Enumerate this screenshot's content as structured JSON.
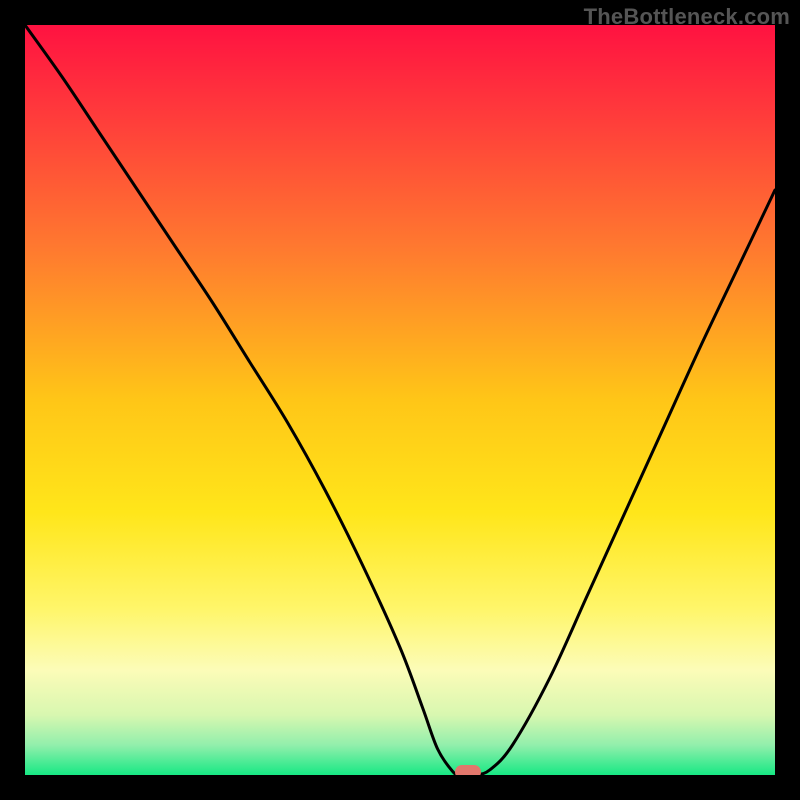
{
  "watermark": "TheBottleneck.com",
  "colors": {
    "frame": "#000000",
    "curve": "#000000",
    "marker": "#e2776c",
    "gradient_stops": [
      {
        "offset": 0.0,
        "color": "#ff1241"
      },
      {
        "offset": 0.12,
        "color": "#ff3b3b"
      },
      {
        "offset": 0.3,
        "color": "#ff7a2f"
      },
      {
        "offset": 0.5,
        "color": "#ffc617"
      },
      {
        "offset": 0.65,
        "color": "#ffe61a"
      },
      {
        "offset": 0.78,
        "color": "#fff66b"
      },
      {
        "offset": 0.86,
        "color": "#fcfcb8"
      },
      {
        "offset": 0.92,
        "color": "#d8f7b0"
      },
      {
        "offset": 0.96,
        "color": "#92efac"
      },
      {
        "offset": 1.0,
        "color": "#17e884"
      }
    ]
  },
  "chart_data": {
    "type": "line",
    "title": "",
    "xlabel": "",
    "ylabel": "",
    "xlim": [
      0,
      100
    ],
    "ylim": [
      0,
      100
    ],
    "series": [
      {
        "name": "bottleneck-curve",
        "x": [
          0,
          5,
          10,
          15,
          20,
          25,
          30,
          35,
          40,
          45,
          50,
          53,
          55,
          57,
          58,
          60,
          62,
          65,
          70,
          75,
          80,
          85,
          90,
          95,
          100
        ],
        "y": [
          100,
          93,
          85.5,
          78,
          70.5,
          63,
          55,
          47,
          38,
          28,
          17,
          9,
          3.5,
          0.5,
          0,
          0,
          0.7,
          4,
          13,
          24,
          35,
          46,
          57,
          67.5,
          78
        ]
      }
    ],
    "annotations": [
      {
        "name": "optimal-marker",
        "x": 59,
        "y": 0
      }
    ]
  }
}
